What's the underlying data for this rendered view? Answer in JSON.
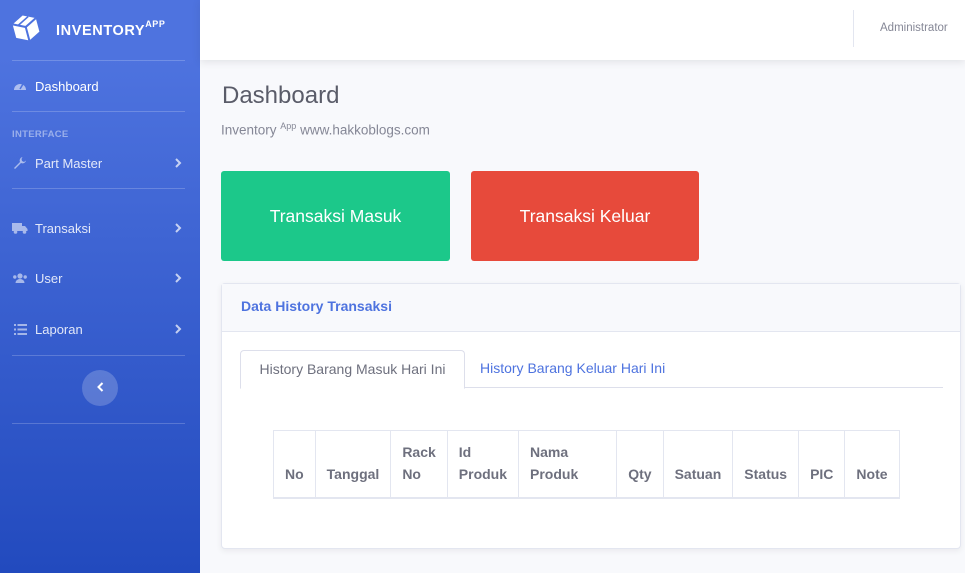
{
  "brand": {
    "name": "INVENTORY",
    "sup": "APP"
  },
  "sidebar": {
    "dashboard": {
      "label": "Dashboard",
      "icon": "tachometer-icon"
    },
    "heading": "INTERFACE",
    "items": [
      {
        "label": "Part Master",
        "icon": "wrench-icon"
      },
      {
        "label": "Transaksi",
        "icon": "truck-icon"
      },
      {
        "label": "User",
        "icon": "users-icon"
      },
      {
        "label": "Laporan",
        "icon": "list-icon"
      }
    ]
  },
  "topbar": {
    "user": "Administrator"
  },
  "page": {
    "title": "Dashboard",
    "subtitle_pre": "Inventory",
    "subtitle_sup": "App",
    "subtitle_post": "www.hakkoblogs.com"
  },
  "actions": {
    "in_label": "Transaksi Masuk",
    "out_label": "Transaksi Keluar",
    "in_color": "#1cc88a",
    "out_color": "#e74a3b"
  },
  "card": {
    "title": "Data History Transaksi",
    "tabs": [
      "History Barang Masuk Hari Ini",
      "History Barang Keluar Hari Ini"
    ],
    "columns": [
      [
        "No"
      ],
      [
        "Tanggal"
      ],
      [
        "Rack",
        "No"
      ],
      [
        "Id",
        "Produk"
      ],
      [
        "Nama",
        "Produk"
      ],
      [
        "Qty"
      ],
      [
        "Satuan"
      ],
      [
        "Status"
      ],
      [
        "PIC"
      ],
      [
        "Note"
      ]
    ]
  },
  "colors": {
    "primary": "#4e73df",
    "sidebar_bottom": "#224abe"
  }
}
